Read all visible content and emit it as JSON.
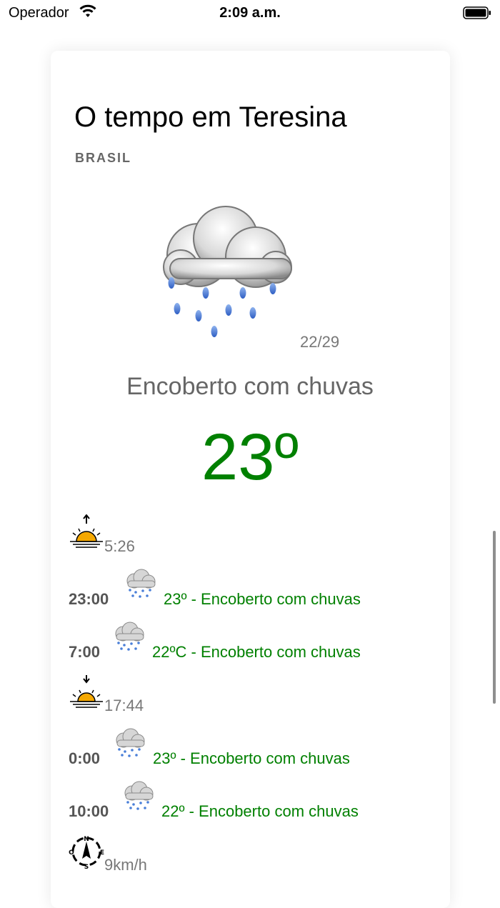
{
  "status_bar": {
    "carrier": "Operador",
    "time": "2:09 a.m."
  },
  "header": {
    "title": "O tempo em Teresina",
    "country": "BRASIL"
  },
  "current": {
    "icon": "rain-cloud-icon",
    "min_max": "22/29",
    "condition": "Encoberto com chuvas",
    "temperature": "23º"
  },
  "details": {
    "sunrise": "5:26",
    "sunset": "17:44",
    "wind": "9km/h",
    "forecast": [
      {
        "hour": "23:00",
        "text": "23º - Encoberto com chuvas"
      },
      {
        "hour": "7:00",
        "text": "22ºC - Encoberto com chuvas"
      },
      {
        "hour": "0:00",
        "text": "23º - Encoberto com chuvas"
      },
      {
        "hour": "10:00",
        "text": "22º - Encoberto com chuvas"
      }
    ]
  },
  "colors": {
    "accent_green": "#008000",
    "muted_text": "#777777"
  }
}
